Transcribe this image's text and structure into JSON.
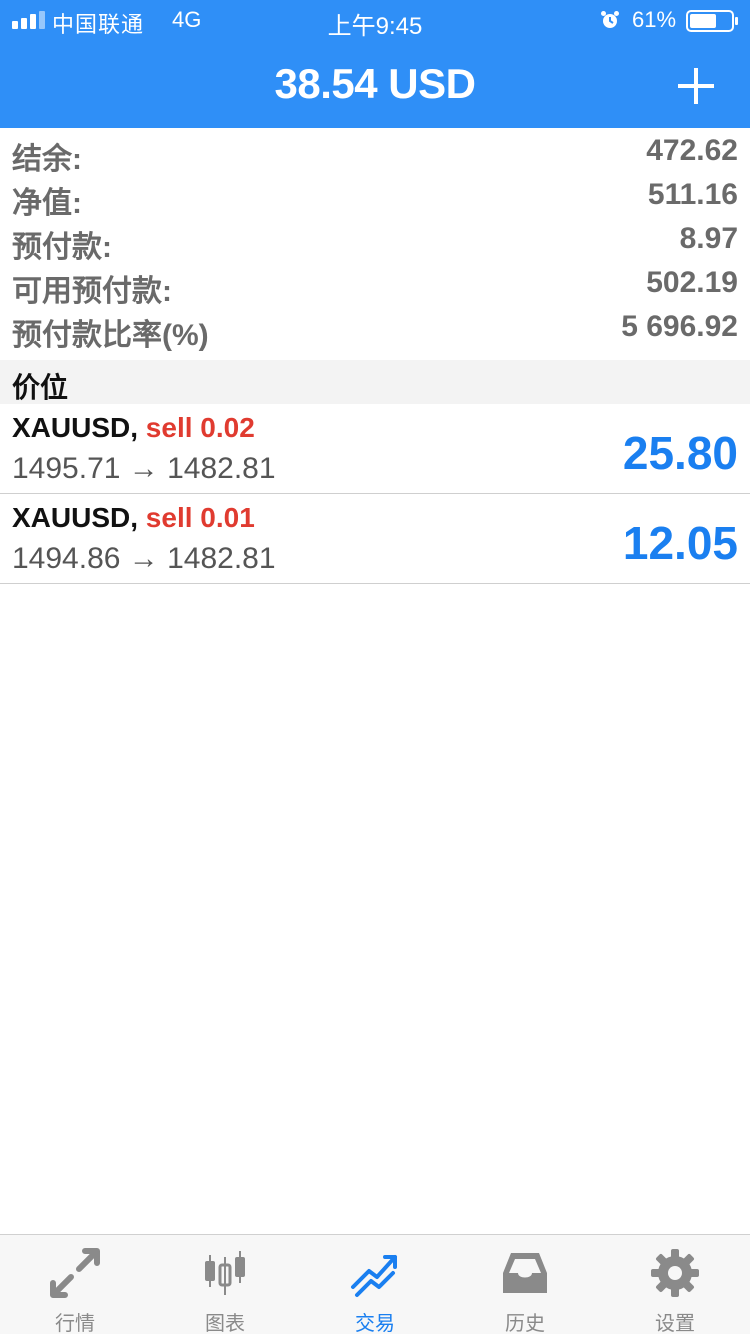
{
  "status_bar": {
    "carrier": "中国联通",
    "network": "4G",
    "time": "上午9:45",
    "battery": "61%"
  },
  "header": {
    "title": "38.54 USD"
  },
  "summary": [
    {
      "label": "结余:",
      "value": "472.62"
    },
    {
      "label": "净值:",
      "value": "511.16"
    },
    {
      "label": "预付款:",
      "value": "8.97"
    },
    {
      "label": "可用预付款:",
      "value": "502.19"
    },
    {
      "label": "预付款比率(%)",
      "value": "5 696.92"
    }
  ],
  "positions_section": {
    "title": "价位"
  },
  "positions": [
    {
      "symbol": "XAUUSD,",
      "side": "sell 0.02",
      "prices": "1495.71 → 1482.81",
      "profit": "25.80"
    },
    {
      "symbol": "XAUUSD,",
      "side": "sell 0.01",
      "prices": "1494.86 → 1482.81",
      "profit": "12.05"
    }
  ],
  "tabs": [
    {
      "label": "行情",
      "icon": "quotes-arrows-icon"
    },
    {
      "label": "图表",
      "icon": "candlestick-chart-icon"
    },
    {
      "label": "交易",
      "icon": "trade-trend-icon",
      "active": true
    },
    {
      "label": "历史",
      "icon": "history-inbox-icon"
    },
    {
      "label": "设置",
      "icon": "gear-icon"
    }
  ],
  "colors": {
    "header_bg": "#2f8ff7",
    "profit": "#1a7ff0",
    "sell": "#e03b30",
    "tab_active": "#1a7ff0",
    "tab_inactive": "#8a8a8a"
  }
}
